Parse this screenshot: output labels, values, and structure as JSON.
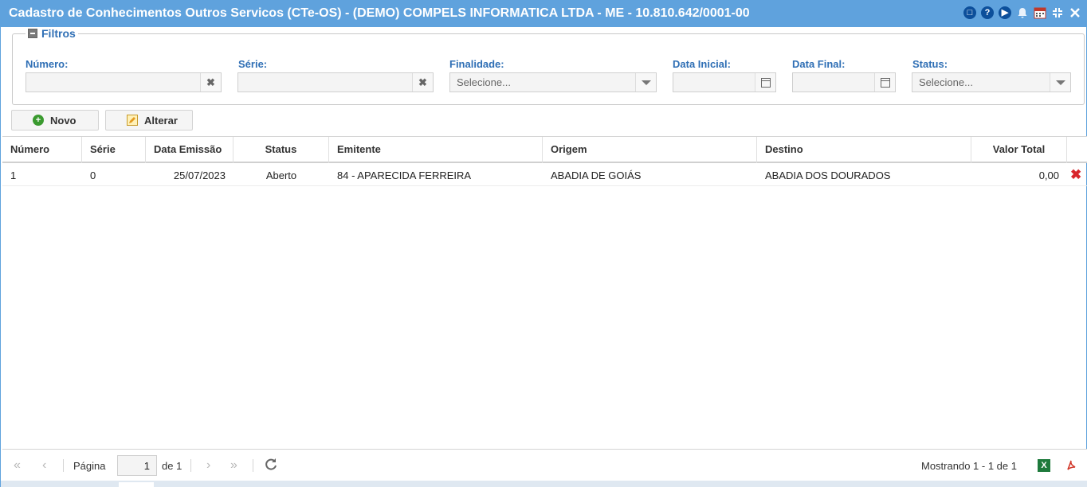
{
  "window": {
    "title": "Cadastro de Conhecimentos Outros Servicos (CTe-OS) - (DEMO) COMPELS INFORMATICA LTDA - ME - 10.810.642/0001-00",
    "tools": [
      {
        "name": "chat-icon",
        "glyph": "□"
      },
      {
        "name": "help-icon",
        "glyph": "?"
      },
      {
        "name": "play-icon",
        "glyph": "▶"
      },
      {
        "name": "bell-icon",
        "glyph": "▲"
      },
      {
        "name": "calendar-icon",
        "glyph": "▦"
      },
      {
        "name": "collapse-icon",
        "glyph": "✖"
      },
      {
        "name": "close-icon",
        "glyph": "✕"
      }
    ]
  },
  "filters": {
    "legend": "Filtros",
    "numero_label": "Número:",
    "serie_label": "Série:",
    "finalidade_label": "Finalidade:",
    "finalidade_value": "Selecione...",
    "data_inicial_label": "Data Inicial:",
    "data_final_label": "Data Final:",
    "status_label": "Status:",
    "status_value": "Selecione..."
  },
  "toolbar": {
    "novo_label": "Novo",
    "alterar_label": "Alterar"
  },
  "grid": {
    "columns": [
      "Número",
      "Série",
      "Data Emissão",
      "Status",
      "Emitente",
      "Origem",
      "Destino",
      "Valor Total"
    ],
    "rows": [
      {
        "numero": "1",
        "serie": "0",
        "data_emissao": "25/07/2023",
        "status": "Aberto",
        "emitente": "84 - APARECIDA FERREIRA",
        "origem": "ABADIA DE GOIÁS",
        "destino": "ABADIA DOS DOURADOS",
        "valor_total": "0,00"
      }
    ]
  },
  "pager": {
    "page_label": "Página",
    "page_value": "1",
    "of_label": "de 1",
    "showing": "Mostrando 1 - 1 de 1"
  }
}
